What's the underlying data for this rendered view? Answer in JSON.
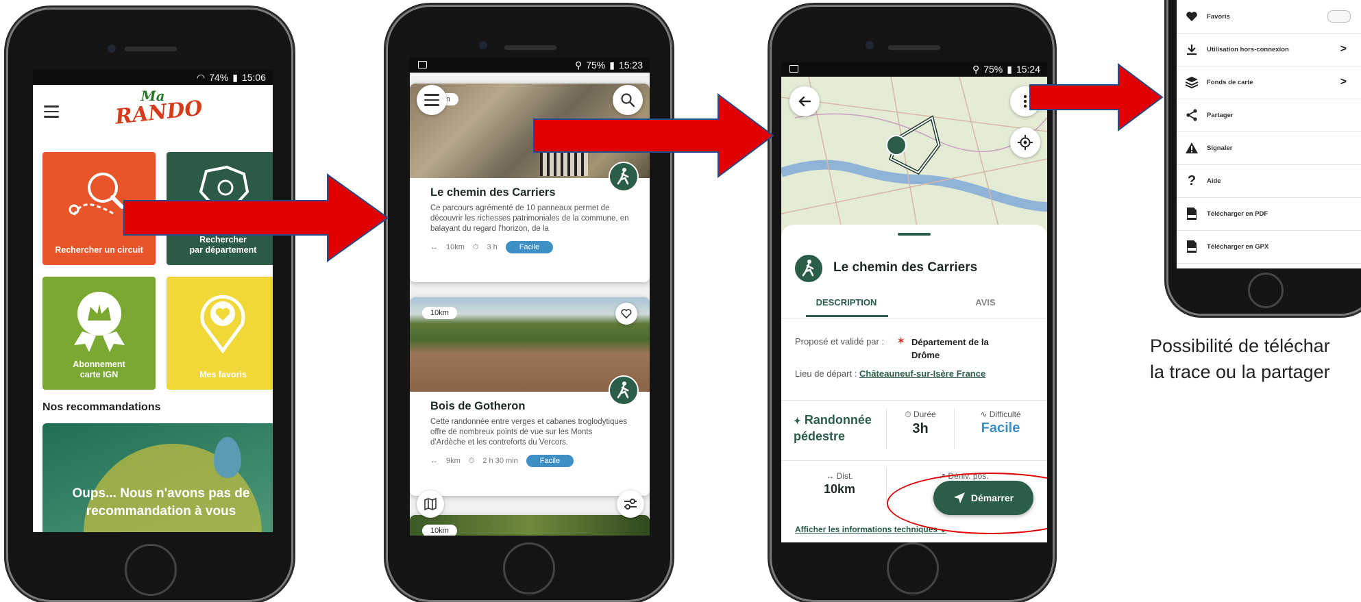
{
  "phone1": {
    "status": "… ◢ 74% ▮ 15:06",
    "status_time": "15:06",
    "status_battery": "74%",
    "logo_top": "Ma",
    "logo_bottom": "RANDO",
    "tiles": [
      {
        "label": "Rechercher un circuit",
        "color": "#e8552b"
      },
      {
        "label": "Rechercher\npar département",
        "color": "#2b5b44"
      },
      {
        "label": "Abonnement\ncarte IGN",
        "color": "#7aa830"
      },
      {
        "label": "Mes favoris",
        "color": "#f0d838"
      }
    ],
    "section_title": "Nos recommandations",
    "reco_text": "Oups... Nous n'avons pas de recommandation à vous"
  },
  "phone2": {
    "status_battery": "75%",
    "status_time": "15:23",
    "cards": [
      {
        "km": "km",
        "title": "Le chemin des Carriers",
        "desc": "Ce parcours agrémenté de 10 panneaux permet de découvrir les richesses patrimoniales de la commune, en balayant du regard l'horizon, de la",
        "distance": "10km",
        "duration": "3 h",
        "difficulty": "Facile"
      },
      {
        "km": "10km",
        "title": "Bois de Gotheron",
        "desc": "Cette randonnée entre verges et cabanes troglodytiques offre de nombreux points de vue sur les Monts d'Ardèche et les contreforts du Vercors.",
        "distance": "9km",
        "duration": "2 h 30 min",
        "difficulty": "Facile"
      },
      {
        "km": "10km"
      }
    ]
  },
  "phone3": {
    "status_battery": "75%",
    "status_time": "15:24",
    "title": "Le chemin des Carriers",
    "tabs": [
      "DESCRIPTION",
      "AVIS"
    ],
    "proposed_label": "Proposé et validé par :",
    "proposed_by": "Département de la Drôme",
    "start_label": "Lieu de départ :",
    "start_place": "Châteauneuf-sur-Isère France",
    "stats": [
      {
        "label": "Randonnée pédestre",
        "value": ""
      },
      {
        "label": "Durée",
        "value": "3h"
      },
      {
        "label": "Difficulté",
        "value": "Facile"
      }
    ],
    "dist_label": "Dist.",
    "dist_value": "10km",
    "deniv_label": "Déniv. pos.",
    "start_button": "Démarrer",
    "tech_link": "Afficher les informations techniques"
  },
  "phone4": {
    "menu": [
      {
        "label": "Favoris",
        "icon": "heart-icon",
        "trail": "toggle"
      },
      {
        "label": "Utilisation hors-connexion",
        "icon": "download-icon",
        "trail": "chevron"
      },
      {
        "label": "Fonds de carte",
        "icon": "layers-icon",
        "trail": "chevron"
      },
      {
        "label": "Partager",
        "icon": "share-icon",
        "trail": ""
      },
      {
        "label": "Signaler",
        "icon": "warning-icon",
        "trail": ""
      },
      {
        "label": "Aide",
        "icon": "help-icon",
        "trail": ""
      },
      {
        "label": "Télécharger en PDF",
        "icon": "pdf-icon",
        "trail": ""
      },
      {
        "label": "Télécharger en GPX",
        "icon": "gpx-icon",
        "trail": ""
      }
    ]
  },
  "caption": {
    "line1": "Possibilité de téléchar",
    "line2": "la trace ou la partager"
  },
  "colors": {
    "arrow": "#e00000",
    "brand_green": "#2b5b44",
    "facile_blue": "#3e8fc4"
  }
}
